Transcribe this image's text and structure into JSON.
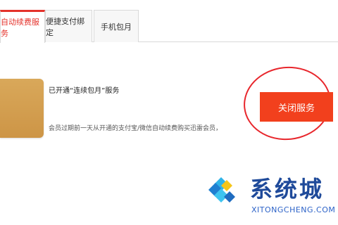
{
  "tabs": [
    {
      "label": "自动续费服务",
      "active": true
    },
    {
      "label": "便捷支付绑定",
      "active": false
    },
    {
      "label": "手机包月",
      "active": false
    }
  ],
  "service": {
    "status_title": "已开通“连续包月”服务",
    "description": "会员过期前一天从开通的支付宝/微信自动续费购买迅雷会员，",
    "close_button_label": "关闭服务"
  },
  "watermark": {
    "title": "系统城",
    "subtitle": "XITONGCHENG.COM"
  },
  "colors": {
    "accent": "#e4322b",
    "button": "#f2401d",
    "avatar": "#d39d4f",
    "watermark_blue": "#1f4a9a"
  },
  "icons": {
    "avatar": "avatar-image",
    "watermark": "diamond-logo-icon"
  }
}
